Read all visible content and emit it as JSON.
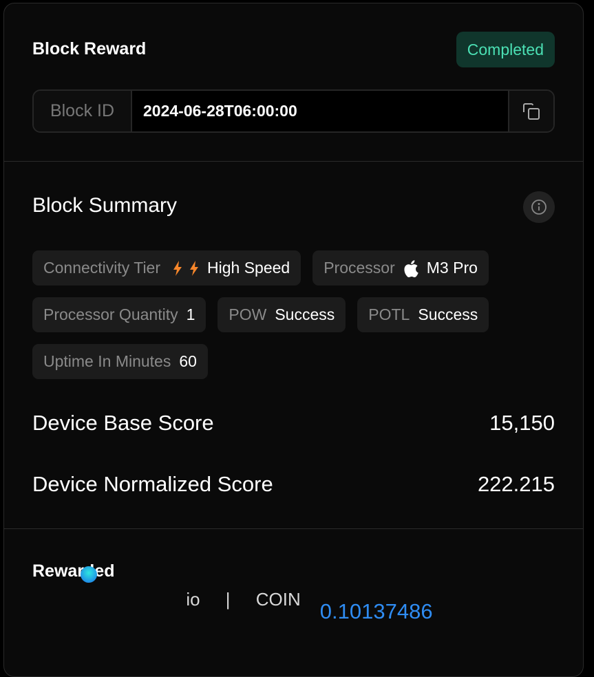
{
  "header": {
    "title": "Block Reward",
    "status": "Completed",
    "block_id_label": "Block ID",
    "block_id": "2024-06-28T06:00:00"
  },
  "summary": {
    "title": "Block Summary",
    "chips": [
      {
        "label": "Connectivity Tier",
        "value": "High Speed",
        "icon": "lightning-icon"
      },
      {
        "label": "Processor",
        "value": "M3 Pro",
        "icon": "apple-icon"
      },
      {
        "label": "Processor Quantity",
        "value": "1"
      },
      {
        "label": "POW",
        "value": "Success"
      },
      {
        "label": "POTL",
        "value": "Success"
      },
      {
        "label": "Uptime In Minutes",
        "value": "60"
      }
    ],
    "base_score_label": "Device Base Score",
    "base_score": "15,150",
    "normalized_score_label": "Device Normalized Score",
    "normalized_score": "222.215"
  },
  "reward": {
    "title": "Rewarded",
    "logo_text": "io | COIN",
    "amount": "0.10137486",
    "amount_color": "#2f8cf2"
  }
}
